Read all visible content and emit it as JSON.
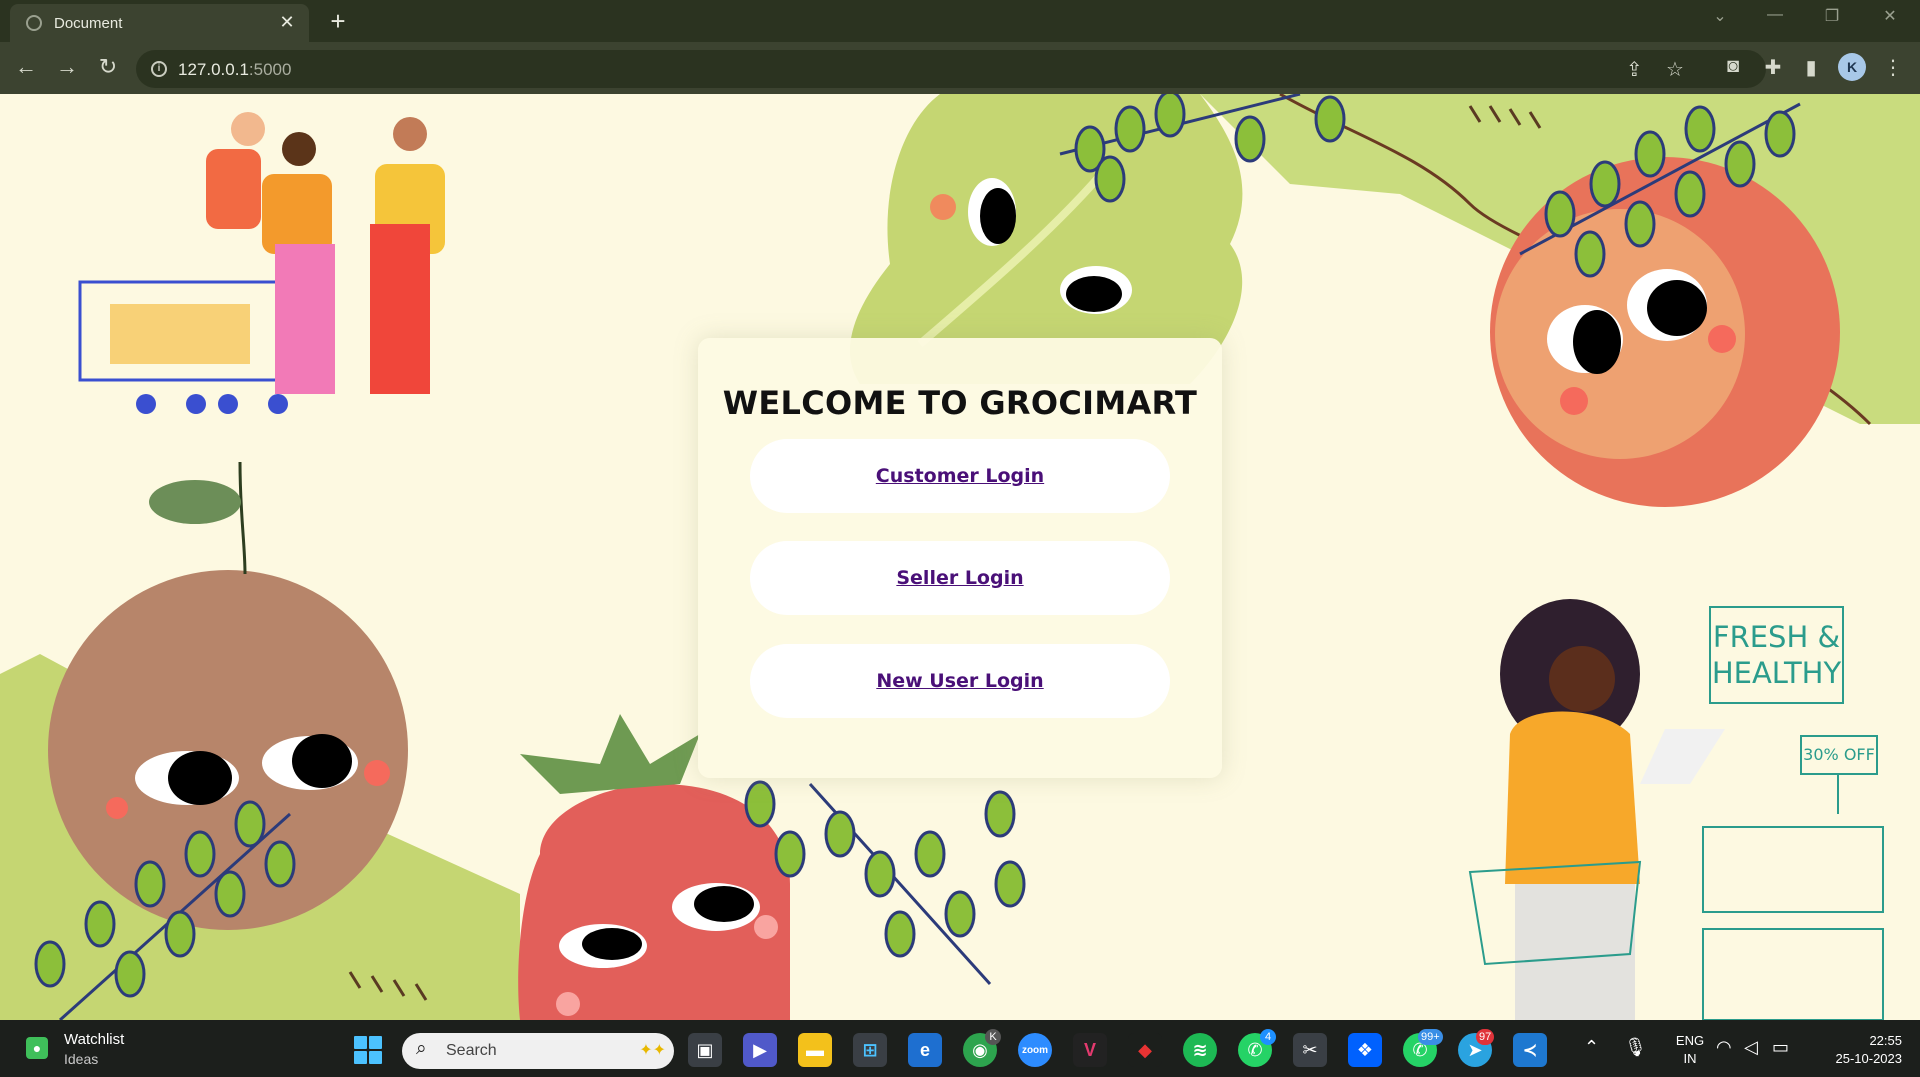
{
  "browser": {
    "tab_title": "Document",
    "tab_close": "✕",
    "new_tab": "+",
    "url_host": "127.0.0.1",
    "url_port": ":5000",
    "profile_initial": "K",
    "window_controls": [
      "⌄",
      "—",
      "❐",
      "✕"
    ]
  },
  "page": {
    "welcome_title": "WELCOME TO GROCIMART",
    "buttons": {
      "customer_login": "Customer Login",
      "seller_login": "Seller Login",
      "new_user_login": "New User Login"
    },
    "sign": {
      "line1": "FRESH &",
      "line2": "HEALTHY",
      "discount": "30% OFF"
    },
    "colors": {
      "background": "#fdf9e1",
      "link": "#4a1078",
      "sign": "#2b9c8c",
      "leaf_green": "#c5d672"
    }
  },
  "taskbar": {
    "widget_title": "Watchlist",
    "widget_subtitle": "Ideas",
    "search_placeholder": "Search",
    "badges": {
      "teams": "",
      "whatsapp": "4",
      "whatsapp2": "99+",
      "telegram": "97",
      "chrome_profile": "K"
    },
    "language": "ENG",
    "region": "IN",
    "time": "22:55",
    "date": "25-10-2023"
  }
}
